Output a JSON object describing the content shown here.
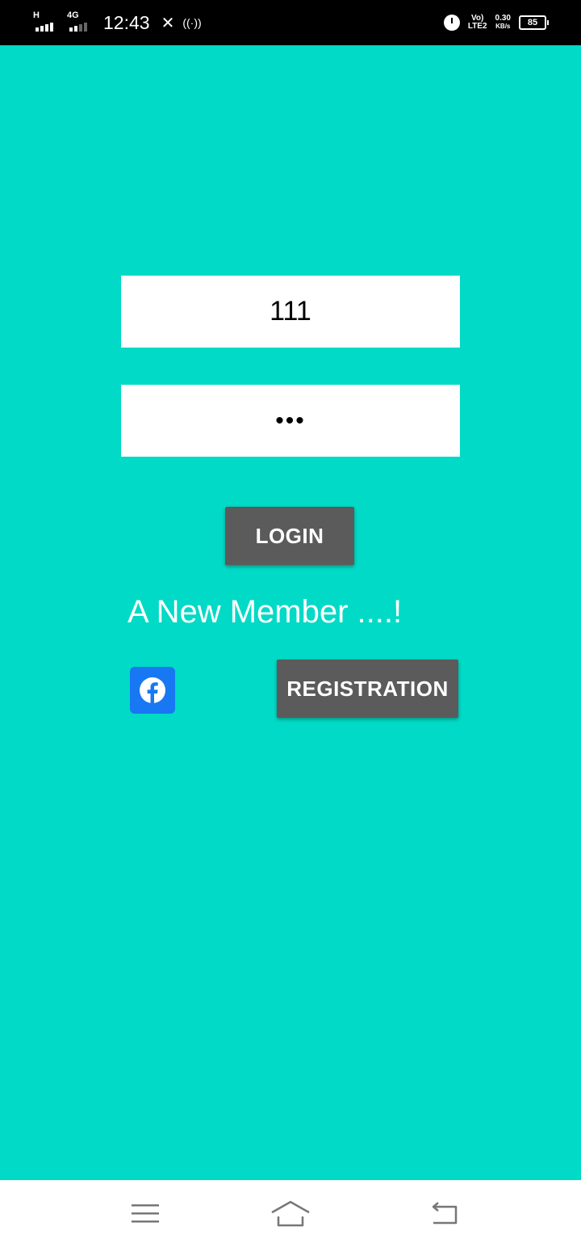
{
  "status_bar": {
    "time": "12:43",
    "sim1_network": "H",
    "sim2_network": "4G",
    "volte_line1": "Vo)",
    "volte_line2": "LTE2",
    "speed_value": "0.30",
    "speed_unit": "KB/s",
    "battery_level": "85",
    "icons": [
      "signal-icon",
      "signal-icon",
      "tools-icon",
      "hotspot-icon",
      "alarm-icon",
      "battery-icon"
    ]
  },
  "login_form": {
    "username_value": "111",
    "password_masked": "•••",
    "login_label": "LOGIN"
  },
  "registration": {
    "prompt": "A New Member ....!",
    "register_label": "REGISTRATION",
    "facebook_icon": "facebook-icon"
  },
  "nav_bar": {
    "icons": [
      "menu-icon",
      "home-icon",
      "back-icon"
    ]
  },
  "colors": {
    "background": "#00DAC6",
    "button": "#5B5B5B",
    "facebook": "#1877F2"
  }
}
